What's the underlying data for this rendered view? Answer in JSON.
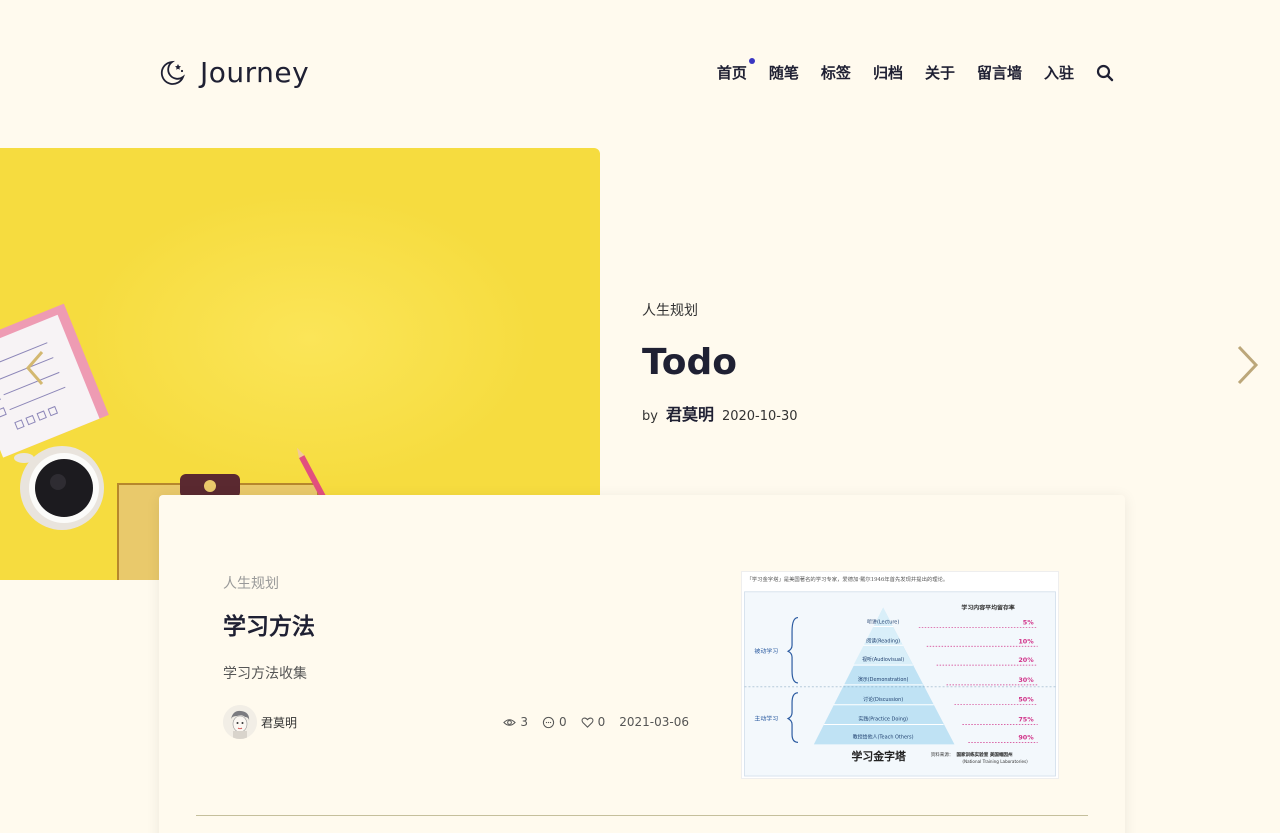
{
  "site": {
    "name": "Journey"
  },
  "nav": {
    "items": [
      {
        "label": "首页",
        "active": true
      },
      {
        "label": "随笔"
      },
      {
        "label": "标签"
      },
      {
        "label": "归档"
      },
      {
        "label": "关于"
      },
      {
        "label": "留言墙"
      },
      {
        "label": "入驻"
      }
    ],
    "search_icon": "search-icon"
  },
  "hero": {
    "category": "人生规划",
    "title": "Todo",
    "by_label": "by",
    "author": "君莫明",
    "date": "2020-10-30"
  },
  "post": {
    "category": "人生规划",
    "title": "学习方法",
    "summary": "学习方法收集",
    "author": "君莫明",
    "views": "3",
    "comments": "0",
    "likes": "0",
    "date": "2021-03-06",
    "thumbnail": {
      "caption": "「学习金字塔」是美国著名的学习专家，爱德加·戴尔1946年首先发现并提出的理论。",
      "header": "学习内容平均留存率",
      "passive_label": "被动学习",
      "active_label": "主动学习",
      "levels": [
        {
          "label": "听讲(Lecture)",
          "rate": "5%"
        },
        {
          "label": "阅读(Reading)",
          "rate": "10%"
        },
        {
          "label": "视听(Audiovisual)",
          "rate": "20%"
        },
        {
          "label": "演示(Demonstration)",
          "rate": "30%"
        },
        {
          "label": "讨论(Discussion)",
          "rate": "50%"
        },
        {
          "label": "实践(Practice Doing)",
          "rate": "75%"
        },
        {
          "label": "教授给他人(Teach Others)",
          "rate": "90%"
        }
      ],
      "pyramid_title": "学习金字塔",
      "source_label": "资料来源：",
      "source_text": "国家训练实验室 美国缅因州",
      "source_en": "(National Training Laboratories)"
    }
  },
  "colors": {
    "background": "#fffaee",
    "hero_yellow": "#f6dc3f",
    "text_dark": "#1f2033",
    "nav_dot": "#3a36c2"
  }
}
